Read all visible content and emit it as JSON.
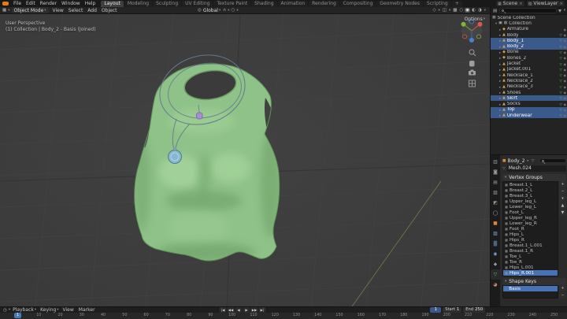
{
  "icons": {
    "caret": "▾",
    "close": "×",
    "scene": "▦",
    "view_layer": "▧",
    "viewport_editor": "▦",
    "outliner_editor": "▤",
    "clock": "◷",
    "pivot": "◎",
    "magnet": "∩",
    "proportional": "○",
    "gizmo": "◇",
    "overlays": "◫",
    "xray": "▩",
    "sphere_wireframe": "○",
    "sphere_solid": "◉",
    "sphere_material": "◐",
    "sphere_rendered": "◑",
    "expand": "▸",
    "checkbox": "▣",
    "collection": "▦",
    "eye": "●",
    "object": "■",
    "mesh_data": "▽",
    "vgroup": "▦",
    "shape_key": "◇",
    "plus": "+",
    "minus": "−",
    "up": "▲",
    "down": "▼"
  },
  "topbar": {
    "menus": [
      "File",
      "Edit",
      "Render",
      "Window",
      "Help"
    ],
    "workspaces": [
      {
        "label": "Layout",
        "active": true
      },
      {
        "label": "Modeling"
      },
      {
        "label": "Sculpting"
      },
      {
        "label": "UV Editing"
      },
      {
        "label": "Texture Paint"
      },
      {
        "label": "Shading"
      },
      {
        "label": "Animation"
      },
      {
        "label": "Rendering"
      },
      {
        "label": "Compositing"
      },
      {
        "label": "Geometry Nodes"
      },
      {
        "label": "Scripting"
      },
      {
        "label": "+"
      }
    ],
    "scene_label": "Scene",
    "view_layer_label": "ViewLayer"
  },
  "viewport_header": {
    "mode": "Object Mode",
    "menus": [
      "View",
      "Select",
      "Add",
      "Object"
    ],
    "orientation": "Global",
    "options": "Options"
  },
  "viewport": {
    "overlay_title": "User Perspective",
    "overlay_subtitle": "(1) Collection | Body_2 - Basis (Joined)"
  },
  "outliner": {
    "scene_collection": "Scene Collection",
    "collection_label": "Collection",
    "items": [
      {
        "label": "Armature",
        "glyph": "◆",
        "color": "#dba24a",
        "data_glyph": ""
      },
      {
        "label": "Body",
        "glyph": "▲",
        "color": "#dba24a",
        "data_glyph": "▽"
      },
      {
        "label": "Body_1",
        "glyph": "▲",
        "color": "#dba24a",
        "data_glyph": "▽",
        "selected": true
      },
      {
        "label": "Body_2",
        "glyph": "▲",
        "color": "#dba24a",
        "data_glyph": "▽",
        "selected": true
      },
      {
        "label": "Bone",
        "glyph": "◆",
        "color": "#dba24a",
        "data_glyph": "▽"
      },
      {
        "label": "Bones_2",
        "glyph": "◆",
        "color": "#dba24a",
        "data_glyph": "▽"
      },
      {
        "label": "Jacket",
        "glyph": "▲",
        "color": "#dba24a",
        "data_glyph": "▽"
      },
      {
        "label": "Jacket.001",
        "glyph": "▲",
        "color": "#dba24a",
        "data_glyph": "▽"
      },
      {
        "label": "Necklace_1",
        "glyph": "▲",
        "color": "#dba24a",
        "data_glyph": "▽"
      },
      {
        "label": "Necklace_2",
        "glyph": "▲",
        "color": "#dba24a",
        "data_glyph": "▽"
      },
      {
        "label": "Necklace_3",
        "glyph": "▲",
        "color": "#dba24a",
        "data_glyph": "▽"
      },
      {
        "label": "Shoes",
        "glyph": "▲",
        "color": "#dba24a",
        "data_glyph": "▽"
      },
      {
        "label": "Skirt",
        "glyph": "▲",
        "color": "#dba24a",
        "data_glyph": "▽",
        "selected": true
      },
      {
        "label": "Socks",
        "glyph": "▲",
        "color": "#dba24a",
        "data_glyph": "▽"
      },
      {
        "label": "Top",
        "glyph": "▲",
        "color": "#dba24a",
        "data_glyph": "▽",
        "selected": true
      },
      {
        "label": "Underwear",
        "glyph": "▲",
        "color": "#dba24a",
        "data_glyph": "▽",
        "selected": true
      }
    ]
  },
  "properties": {
    "tabs": [
      {
        "name": "tool",
        "glyph": "▥",
        "color": "#9a9a9a"
      },
      {
        "name": "render",
        "glyph": "◙",
        "color": "#9a9a9a"
      },
      {
        "name": "output",
        "glyph": "▤",
        "color": "#9a9a9a"
      },
      {
        "name": "view-layer",
        "glyph": "▧",
        "color": "#9a9a9a"
      },
      {
        "name": "scene",
        "glyph": "◩",
        "color": "#9a9a9a"
      },
      {
        "name": "world",
        "glyph": "◯",
        "color": "#8fb6d6"
      },
      {
        "name": "object",
        "glyph": "■",
        "color": "#e0883a"
      },
      {
        "name": "modifiers",
        "glyph": "▨",
        "color": "#7aa5d8"
      },
      {
        "name": "particles",
        "glyph": "▒",
        "color": "#7aa5d8"
      },
      {
        "name": "physics",
        "glyph": "◉",
        "color": "#7aa5d8"
      },
      {
        "name": "constraints",
        "glyph": "◆",
        "color": "#9a9a9a"
      },
      {
        "name": "data",
        "glyph": "▽",
        "color": "#5fbf63",
        "active": true
      },
      {
        "name": "material",
        "glyph": "◕",
        "color": "#cf8a6a"
      }
    ],
    "breadcrumb_object": "Body_2",
    "mesh_name": "Mesh.024",
    "vertex_groups_label": "Vertex Groups",
    "shape_keys_label": "Shape Keys",
    "vertex_groups": [
      {
        "name": "Breast.1_L"
      },
      {
        "name": "Breast.2_L"
      },
      {
        "name": "Breast.3_L"
      },
      {
        "name": "Upper_leg_L"
      },
      {
        "name": "Lower_leg_L"
      },
      {
        "name": "Foot_L"
      },
      {
        "name": "Upper_leg_R"
      },
      {
        "name": "Lower_leg_R"
      },
      {
        "name": "Foot_R"
      },
      {
        "name": "Hips_L"
      },
      {
        "name": "Hips_R"
      },
      {
        "name": "Breast.1_L.001"
      },
      {
        "name": "Breast.1_R"
      },
      {
        "name": "Toe_L"
      },
      {
        "name": "Toe_R"
      },
      {
        "name": "Hips_L.001"
      },
      {
        "name": "Hips_R.001",
        "selected": true
      }
    ],
    "shape_keys": [
      {
        "name": "Basis",
        "selected": true
      }
    ]
  },
  "timeline": {
    "menus": [
      {
        "label": "Playback",
        "caret": "▾"
      },
      {
        "label": "Keying",
        "caret": "▾"
      },
      {
        "label": "View",
        "caret": ""
      },
      {
        "label": "Marker",
        "caret": ""
      }
    ],
    "transport": [
      "|◀",
      "◀◀",
      "◀",
      "▶",
      "▶▶",
      "▶|"
    ],
    "frame_field": "1",
    "current_frame": "1",
    "start_label": "Start",
    "start_value": "1",
    "end_label": "End",
    "end_value": "250",
    "ticks": [
      "0",
      "10",
      "20",
      "30",
      "40",
      "50",
      "60",
      "70",
      "80",
      "90",
      "100",
      "110",
      "120",
      "130",
      "140",
      "150",
      "160",
      "170",
      "180",
      "190",
      "200",
      "210",
      "220",
      "230",
      "240",
      "250"
    ]
  }
}
